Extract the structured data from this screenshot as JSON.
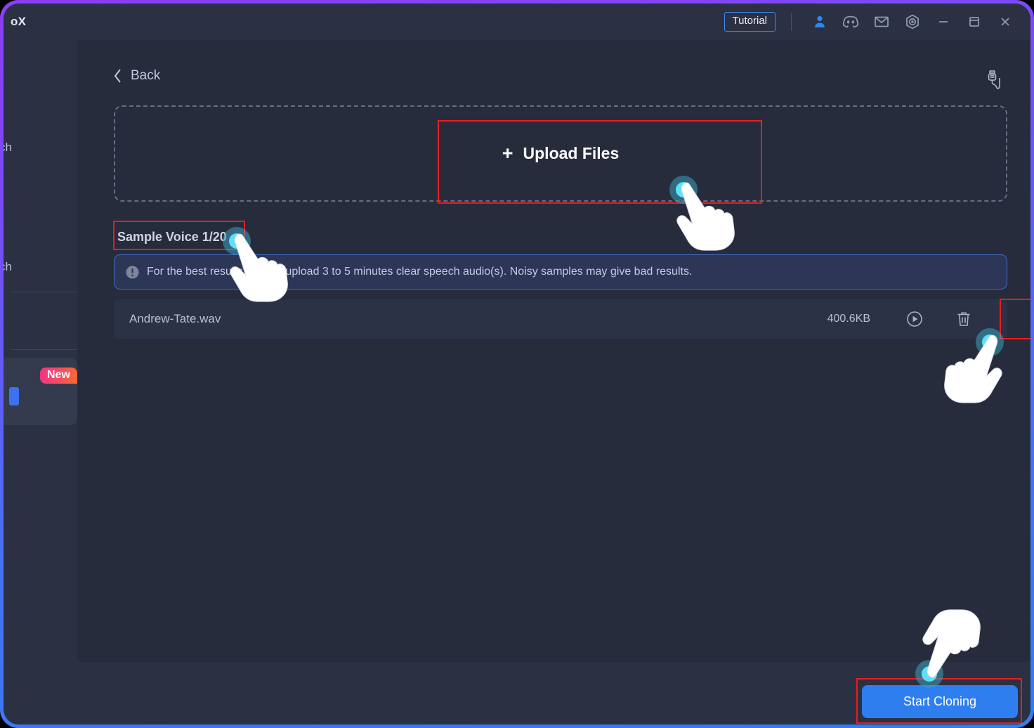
{
  "window": {
    "app_title": "oX",
    "accent_purple": "#8b3df5",
    "accent_blue": "#2f7ef0",
    "highlight_red": "#ee1b1b",
    "titlebar_bg": "#2b3142",
    "content_bg": "#262c3c"
  },
  "titlebar": {
    "tutorial_label": "Tutorial",
    "icons": [
      {
        "name": "user-account-icon",
        "label": "Account"
      },
      {
        "name": "discord-icon",
        "label": "Discord"
      },
      {
        "name": "mail-icon",
        "label": "Mail"
      },
      {
        "name": "settings-icon",
        "label": "Settings"
      }
    ],
    "window_controls": [
      {
        "name": "minimize-button",
        "label": "Minimize"
      },
      {
        "name": "maximize-button",
        "label": "Maximize"
      },
      {
        "name": "close-button",
        "label": "Close"
      }
    ]
  },
  "sidebar": {
    "item_1_label": "ch",
    "item_2_label": "ch",
    "new_badge": "New"
  },
  "main": {
    "back_label": "Back",
    "voice_tool_icon": "microphone-plug-icon",
    "upload": {
      "plus": "+",
      "label": "Upload Files"
    },
    "sample_heading": "Sample Voice 1/20",
    "tip": {
      "icon": "exclamation-circle-icon",
      "text": "For the best results, please upload 3 to 5 minutes clear speech audio(s). Noisy samples may give bad results."
    },
    "file": {
      "name": "Andrew-Tate.wav",
      "size": "400.6KB",
      "play_icon": "play-circle-icon",
      "delete_icon": "trash-icon"
    }
  },
  "footer": {
    "start_cloning_label": "Start Cloning"
  },
  "annotations": {
    "cursor_count": 3,
    "highlight_boxes": [
      "upload-files-highlight",
      "sample-voice-highlight",
      "delete-file-highlight",
      "start-cloning-highlight"
    ]
  }
}
